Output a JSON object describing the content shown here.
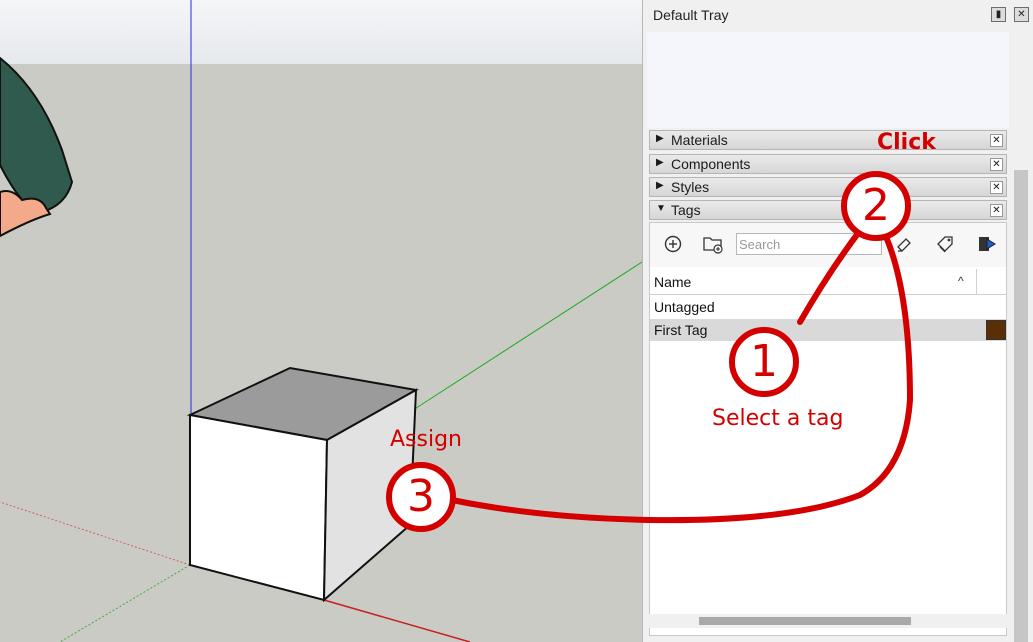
{
  "tray": {
    "title": "Default Tray",
    "pin_icon": "pin-icon",
    "close_icon": "close-icon"
  },
  "panels": [
    {
      "label": "Materials",
      "expanded": false
    },
    {
      "label": "Components",
      "expanded": false
    },
    {
      "label": "Styles",
      "expanded": false
    },
    {
      "label": "Tags",
      "expanded": true
    }
  ],
  "tags_toolbar": {
    "add_icon": "add-tag-icon",
    "add_folder_icon": "add-folder-icon",
    "search_placeholder": "Search",
    "color_icon": "color-by-tag-icon",
    "tags_icon": "tag-tools-icon",
    "details_icon": "details-arrow-icon"
  },
  "tags_table": {
    "column_name": "Name",
    "rows": [
      {
        "name": "Untagged",
        "selected": false,
        "color": ""
      },
      {
        "name": "First Tag",
        "selected": true,
        "color": "#5a2f06"
      }
    ]
  },
  "annotations": {
    "click": "Click",
    "select_a_tag": "Select a tag",
    "assign": "Assign",
    "step1": "1",
    "step2": "2",
    "step3": "3",
    "color": "#d40000"
  }
}
